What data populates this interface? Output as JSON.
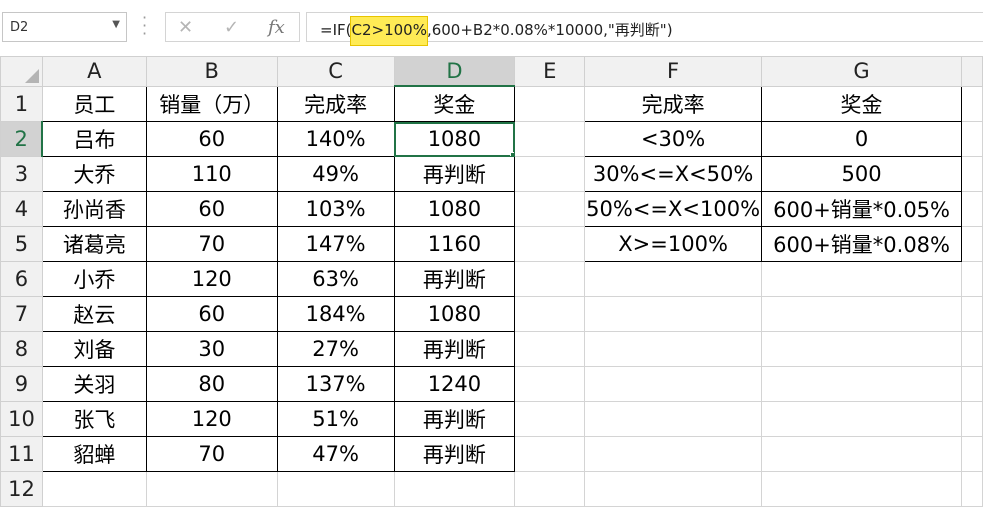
{
  "name_box": "D2",
  "formula": {
    "prefix": "=IF(",
    "highlight": "C2>100%",
    "suffix": ",600+B2*0.08%*10000,\"再判断\")"
  },
  "columns": [
    "A",
    "B",
    "C",
    "D",
    "E",
    "F",
    "G"
  ],
  "row_numbers": [
    "1",
    "2",
    "3",
    "4",
    "5",
    "6",
    "7",
    "8",
    "9",
    "10",
    "11",
    "12"
  ],
  "headers": {
    "employee": "员工",
    "sales": "销量（万）",
    "completion": "完成率",
    "bonus": "奖金"
  },
  "rows": [
    {
      "name": "吕布",
      "sales": "60",
      "rate": "140%",
      "bonus": "1080"
    },
    {
      "name": "大乔",
      "sales": "110",
      "rate": "49%",
      "bonus": "再判断"
    },
    {
      "name": "孙尚香",
      "sales": "60",
      "rate": "103%",
      "bonus": "1080"
    },
    {
      "name": "诸葛亮",
      "sales": "70",
      "rate": "147%",
      "bonus": "1160"
    },
    {
      "name": "小乔",
      "sales": "120",
      "rate": "63%",
      "bonus": "再判断"
    },
    {
      "name": "赵云",
      "sales": "60",
      "rate": "184%",
      "bonus": "1080"
    },
    {
      "name": "刘备",
      "sales": "30",
      "rate": "27%",
      "bonus": "再判断"
    },
    {
      "name": "关羽",
      "sales": "80",
      "rate": "137%",
      "bonus": "1240"
    },
    {
      "name": "张飞",
      "sales": "120",
      "rate": "51%",
      "bonus": "再判断"
    },
    {
      "name": "貂蝉",
      "sales": "70",
      "rate": "47%",
      "bonus": "再判断"
    }
  ],
  "rule_table": {
    "headers": {
      "rate": "完成率",
      "bonus": "奖金"
    },
    "rows": [
      {
        "rate": "<30%",
        "bonus": "0"
      },
      {
        "rate": "30%<=X<50%",
        "bonus": "500"
      },
      {
        "rate": "50%<=X<100%",
        "bonus": "600+销量*0.05%"
      },
      {
        "rate": "X>=100%",
        "bonus": "600+销量*0.08%"
      }
    ]
  }
}
